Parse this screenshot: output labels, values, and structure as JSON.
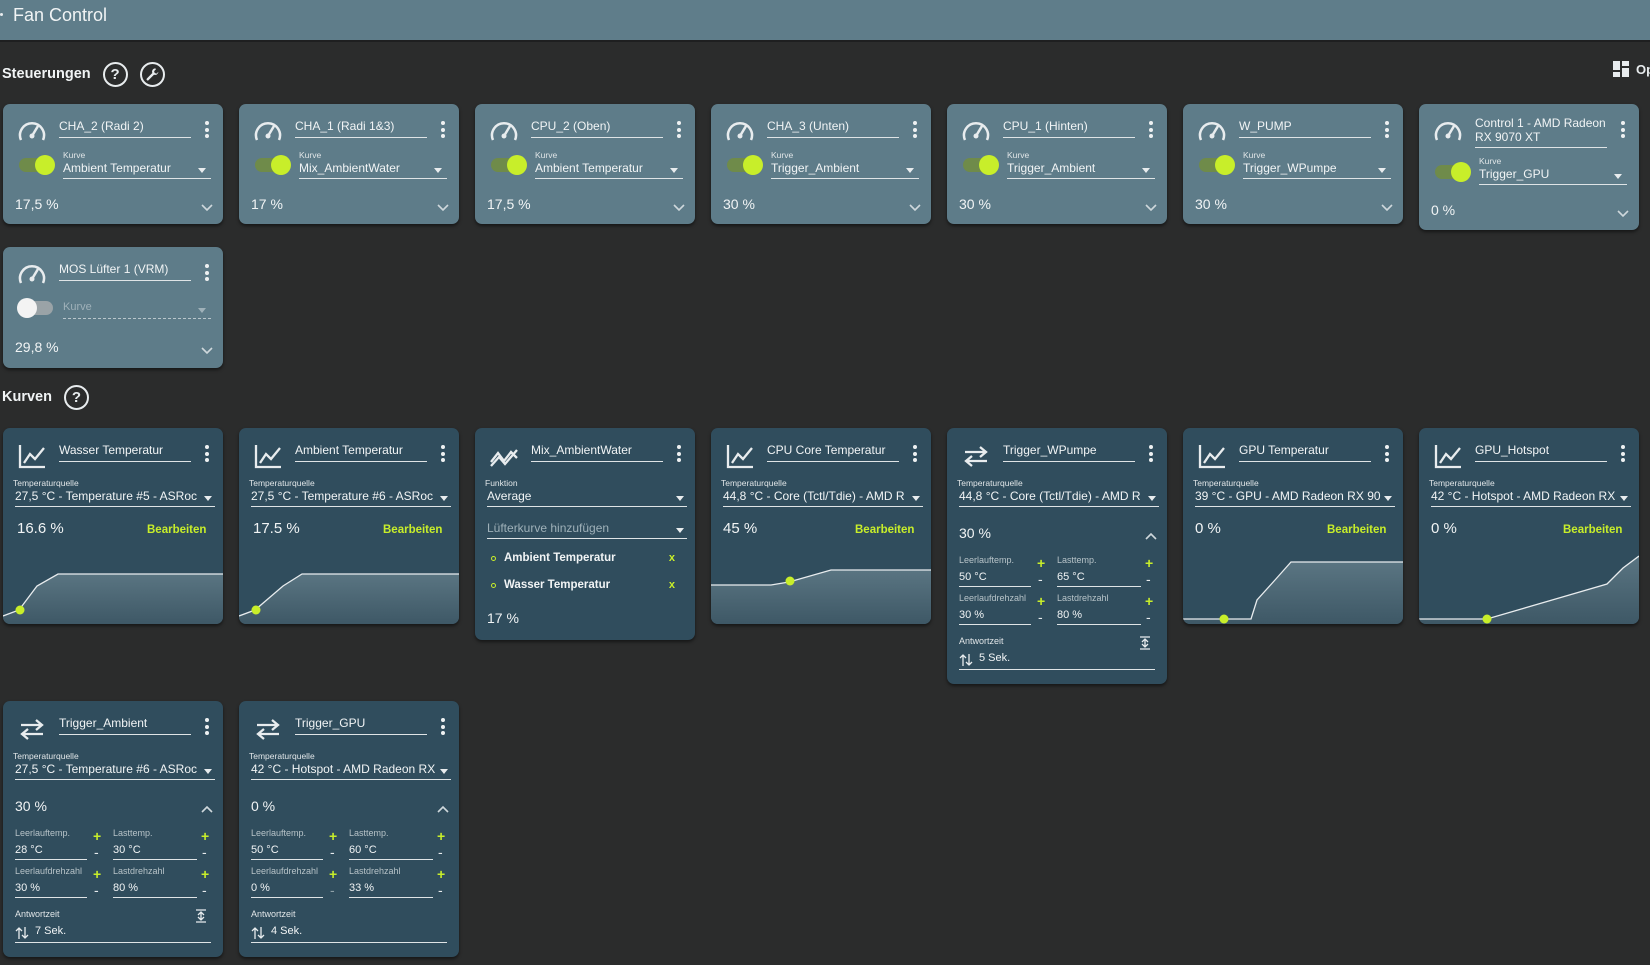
{
  "app": {
    "title": "Fan Control"
  },
  "sections": {
    "controls": "Steuerungen",
    "curves": "Kurven",
    "help_glyph": "?",
    "layout_label": "Op"
  },
  "labels": {
    "curve": "Kurve",
    "temp_source": "Temperaturquelle",
    "function": "Funktion",
    "edit": "Bearbeiten",
    "add_curve": "Lüfterkurve hinzufügen",
    "idle_temp": "Leerlauftemp.",
    "load_temp": "Lasttemp.",
    "idle_speed": "Leerlaufdrehzahl",
    "load_speed": "Lastdrehzahl",
    "response": "Antwortzeit",
    "plus": "+",
    "minus": "-",
    "remove": "x"
  },
  "controls": [
    {
      "name": "CHA_2 (Radi 2)",
      "curve": "Ambient Temperatur",
      "enabled": true,
      "value": "17,5 %"
    },
    {
      "name": "CHA_1 (Radi 1&3)",
      "curve": "Mix_AmbientWater",
      "enabled": true,
      "value": "17 %"
    },
    {
      "name": "CPU_2 (Oben)",
      "curve": "Ambient Temperatur",
      "enabled": true,
      "value": "17,5 %"
    },
    {
      "name": "CHA_3 (Unten)",
      "curve": "Trigger_Ambient",
      "enabled": true,
      "value": "30 %"
    },
    {
      "name": "CPU_1 (Hinten)",
      "curve": "Trigger_Ambient",
      "enabled": true,
      "value": "30 %"
    },
    {
      "name": "W_PUMP",
      "curve": "Trigger_WPumpe",
      "enabled": true,
      "value": "30 %"
    },
    {
      "name": "Control 1 - AMD Radeon RX 9070 XT",
      "curve": "Trigger_GPU",
      "enabled": true,
      "value": "0 %"
    },
    {
      "name": "MOS Lüfter 1 (VRM)",
      "curve": "Kurve",
      "enabled": false,
      "value": "29,8 %"
    }
  ],
  "curves": {
    "wasser": {
      "name": "Wasser Temperatur",
      "source": "27,5 °C - Temperature #5 - ASRoc",
      "value": "16.6 %"
    },
    "ambient": {
      "name": "Ambient Temperatur",
      "source": "27,5 °C - Temperature #6 - ASRoc",
      "value": "17.5 %"
    },
    "mix": {
      "name": "Mix_AmbientWater",
      "function": "Average",
      "items": [
        "Ambient Temperatur",
        "Wasser Temperatur"
      ],
      "value": "17 %"
    },
    "cpu": {
      "name": "CPU Core Temperatur",
      "source": "44,8 °C - Core (Tctl/Tdie) - AMD R",
      "value": "45 %"
    },
    "trigger_wpumpe": {
      "name": "Trigger_WPumpe",
      "source": "44,8 °C - Core (Tctl/Tdie) - AMD R",
      "value": "30 %",
      "idle_temp": "50 °C",
      "load_temp": "65 °C",
      "idle_speed": "30 %",
      "load_speed": "80 %",
      "response": "5 Sek."
    },
    "gpu": {
      "name": "GPU Temperatur",
      "source": "39 °C - GPU - AMD Radeon RX 90",
      "value": "0 %"
    },
    "gpu_hotspot": {
      "name": "GPU_Hotspot",
      "source": "42 °C - Hotspot - AMD Radeon RX",
      "value": "0 %"
    },
    "trigger_ambient": {
      "name": "Trigger_Ambient",
      "source": "27,5 °C - Temperature #6 - ASRoc",
      "value": "30 %",
      "idle_temp": "28 °C",
      "load_temp": "30 °C",
      "idle_speed": "30 %",
      "load_speed": "80 %",
      "response": "7 Sek."
    },
    "trigger_gpu": {
      "name": "Trigger_GPU",
      "source": "42 °C - Hotspot - AMD Radeon RX",
      "value": "0 %",
      "idle_temp": "50 °C",
      "load_temp": "60 °C",
      "idle_speed": "0 %",
      "load_speed": "33 %",
      "response": "4 Sek."
    }
  },
  "colors": {
    "accent": "#c8ee2a",
    "control_card": "#5e7c89",
    "curve_card": "#304d5d",
    "background": "#2b2c2c",
    "topbar": "#5f7d8a"
  }
}
